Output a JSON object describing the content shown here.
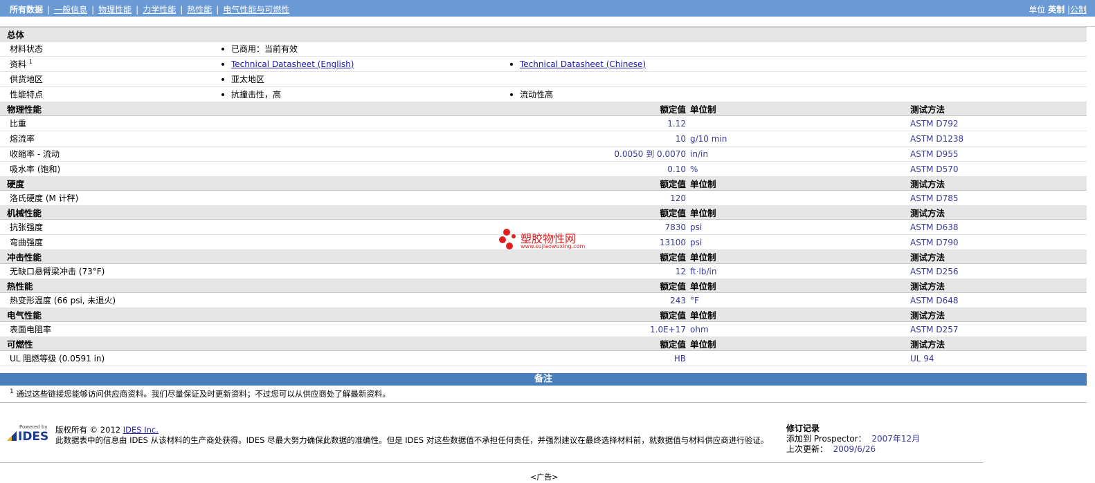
{
  "nav": {
    "tabs": [
      {
        "label": "所有数据"
      },
      {
        "label": "一般信息"
      },
      {
        "label": "物理性能"
      },
      {
        "label": "力学性能"
      },
      {
        "label": "热性能"
      },
      {
        "label": "电气性能与可燃性"
      }
    ],
    "units_label": "单位",
    "units_selected": "英制",
    "units_other": "公制"
  },
  "general": {
    "title": "总体",
    "rows": [
      {
        "name": "材料状态",
        "v1": "已商用：当前有效",
        "v2": ""
      },
      {
        "name": "资料",
        "sup": "1",
        "v1": "Technical Datasheet (English)",
        "v2": "Technical Datasheet (Chinese)"
      },
      {
        "name": "供货地区",
        "v1": "亚太地区",
        "v2": ""
      },
      {
        "name": "性能特点",
        "v1": "抗撞击性，高",
        "v2": "流动性高"
      }
    ]
  },
  "headers": {
    "value": "额定值",
    "unit": "单位制",
    "method": "测试方法"
  },
  "sections": [
    {
      "title": "物理性能",
      "rows": [
        {
          "name": "比重",
          "value": "1.12",
          "unit": "",
          "method": "ASTM D792"
        },
        {
          "name": "熔流率",
          "value": "10",
          "unit": "g/10 min",
          "method": "ASTM D1238"
        },
        {
          "name": "收缩率  - 流动",
          "value": "0.0050 到  0.0070",
          "unit": "in/in",
          "method": "ASTM D955"
        },
        {
          "name": "吸水率 (饱和)",
          "value": "0.10",
          "unit": "%",
          "method": "ASTM D570"
        }
      ]
    },
    {
      "title": "硬度",
      "rows": [
        {
          "name": "洛氏硬度 (M 计秤)",
          "value": "120",
          "unit": "",
          "method": "ASTM D785"
        }
      ]
    },
    {
      "title": "机械性能",
      "rows": [
        {
          "name": "抗张强度",
          "value": "7830",
          "unit": "psi",
          "method": "ASTM D638"
        },
        {
          "name": "弯曲强度",
          "value": "13100",
          "unit": "psi",
          "method": "ASTM D790"
        }
      ]
    },
    {
      "title": "冲击性能",
      "rows": [
        {
          "name": "无缺口悬臂梁冲击 (73°F)",
          "value": "12",
          "unit": "ft·lb/in",
          "method": "ASTM D256"
        }
      ]
    },
    {
      "title": "热性能",
      "rows": [
        {
          "name": "热变形温度 (66 psi, 未退火)",
          "value": "243",
          "unit": "°F",
          "method": "ASTM D648"
        }
      ]
    },
    {
      "title": "电气性能",
      "rows": [
        {
          "name": "表面电阻率",
          "value": "1.0E+17",
          "unit": "ohm",
          "method": "ASTM D257"
        }
      ]
    },
    {
      "title": "可燃性",
      "rows": [
        {
          "name": "UL 阻燃等级 (0.0591 in)",
          "value": "HB",
          "unit": "",
          "method": "UL 94"
        }
      ]
    }
  ],
  "notes": {
    "title": "备注",
    "sup": "1",
    "text": "通过这些链接您能够访问供应商资料。我们尽量保证及时更新资料；不过您可以从供应商处了解最新资料。"
  },
  "footer": {
    "powered_by": "Powered by",
    "logo_text": "IDES",
    "copyright": "版权所有  © 2012",
    "company": "IDES Inc.",
    "disclaimer": "此数据表中的信息由  IDES 从该材料的生产商处获得。IDES 尽最大努力确保此数据的准确性。但是  IDES 对这些数据值不承担任何责任，并强烈建议在最终选择材料前，就数据值与材料供应商进行验证。",
    "revision_title": "修订记录",
    "added_label": "添加到 Prospector：",
    "added_value": "2007年12月",
    "updated_label": "上次更新：",
    "updated_value": "2009/6/26"
  },
  "ad": "<广告>",
  "watermark": {
    "cn": "塑胶物性网",
    "en": "www.sujiaowuxing.com",
    "color": "#e02020"
  }
}
